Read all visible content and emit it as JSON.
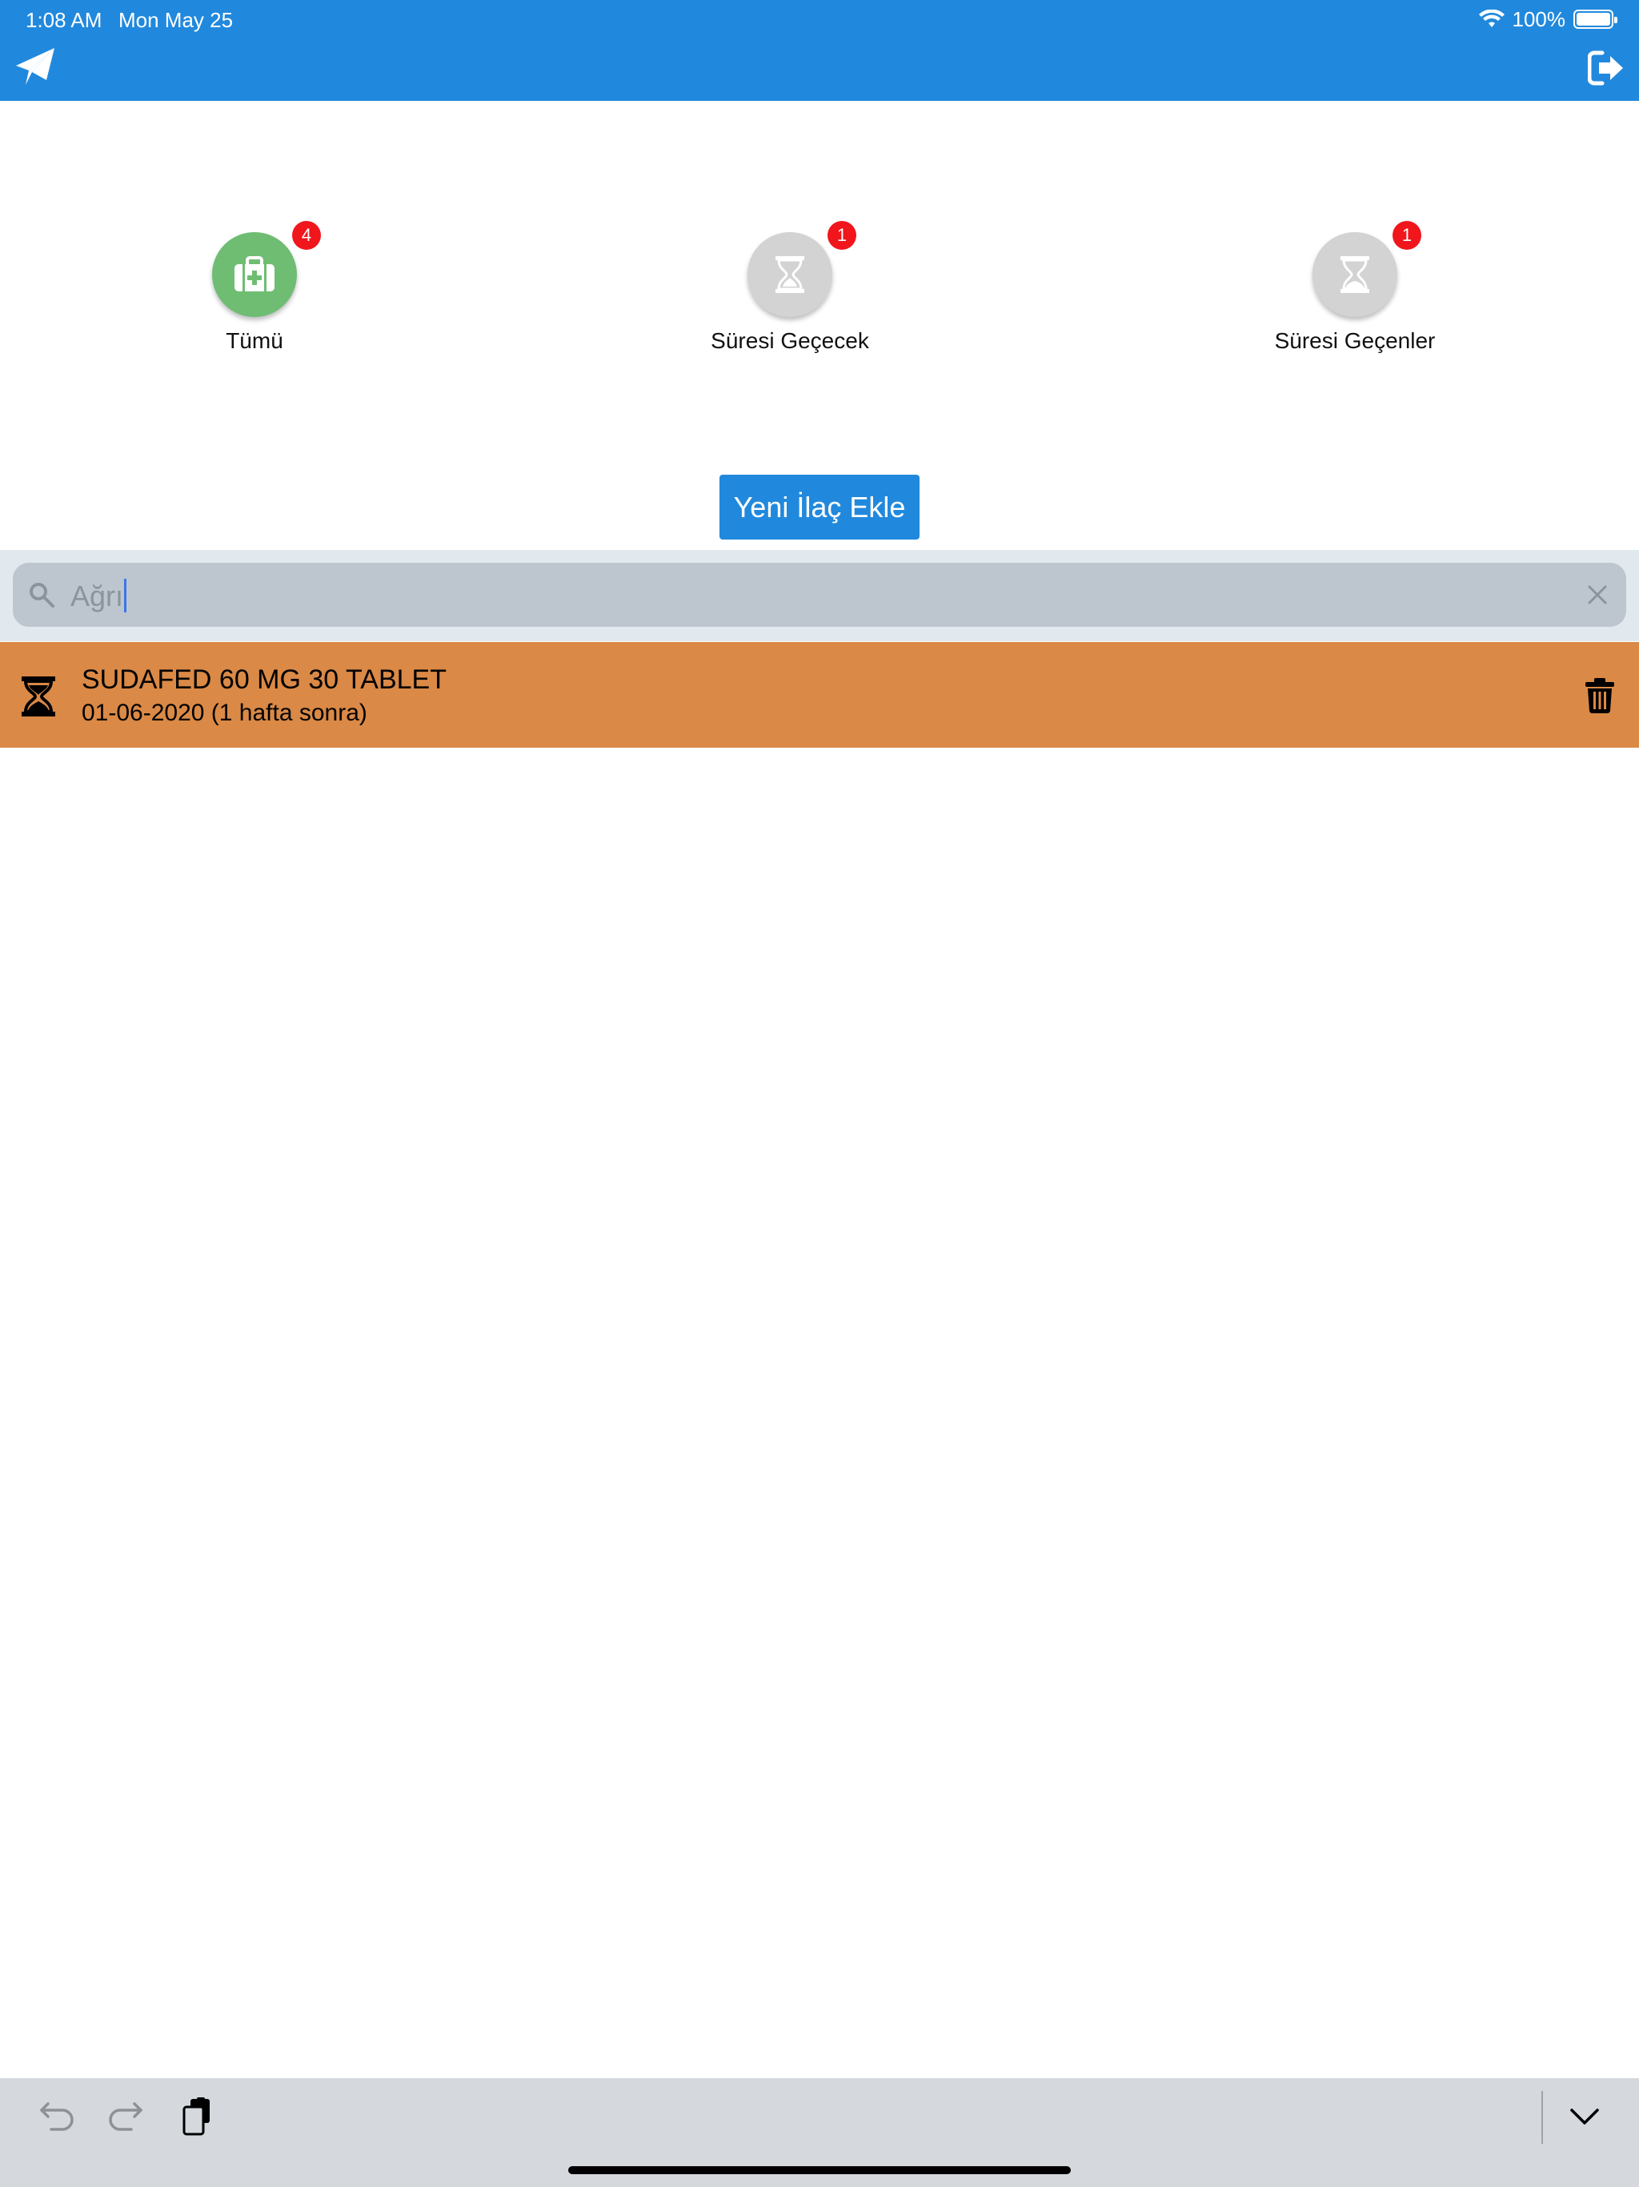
{
  "status_bar": {
    "time": "1:08 AM",
    "date": "Mon May 25",
    "battery": "100%",
    "battery_level": 1.0
  },
  "header": {
    "left_icon": "paper-plane-icon",
    "right_icon": "sign-out-icon"
  },
  "categories": [
    {
      "label": "Tümü",
      "badge": "4",
      "icon": "first-aid-kit-icon",
      "color": "#6fbd73"
    },
    {
      "label": "Süresi Geçecek",
      "badge": "1",
      "icon": "hourglass-icon",
      "color": "#d3d3d3"
    },
    {
      "label": "Süresi Geçenler",
      "badge": "1",
      "icon": "hourglass-icon",
      "color": "#d3d3d3"
    }
  ],
  "add_button": {
    "label": "Yeni İlaç Ekle"
  },
  "search": {
    "value": "Ağrı"
  },
  "list": [
    {
      "title": "SUDAFED 60 MG 30 TABLET",
      "subtitle": "01-06-2020 (1 hafta sonra)",
      "color": "#da8946"
    }
  ],
  "colors": {
    "primary": "#2189dd",
    "badge": "#f0161c",
    "warning_row": "#da8946"
  }
}
